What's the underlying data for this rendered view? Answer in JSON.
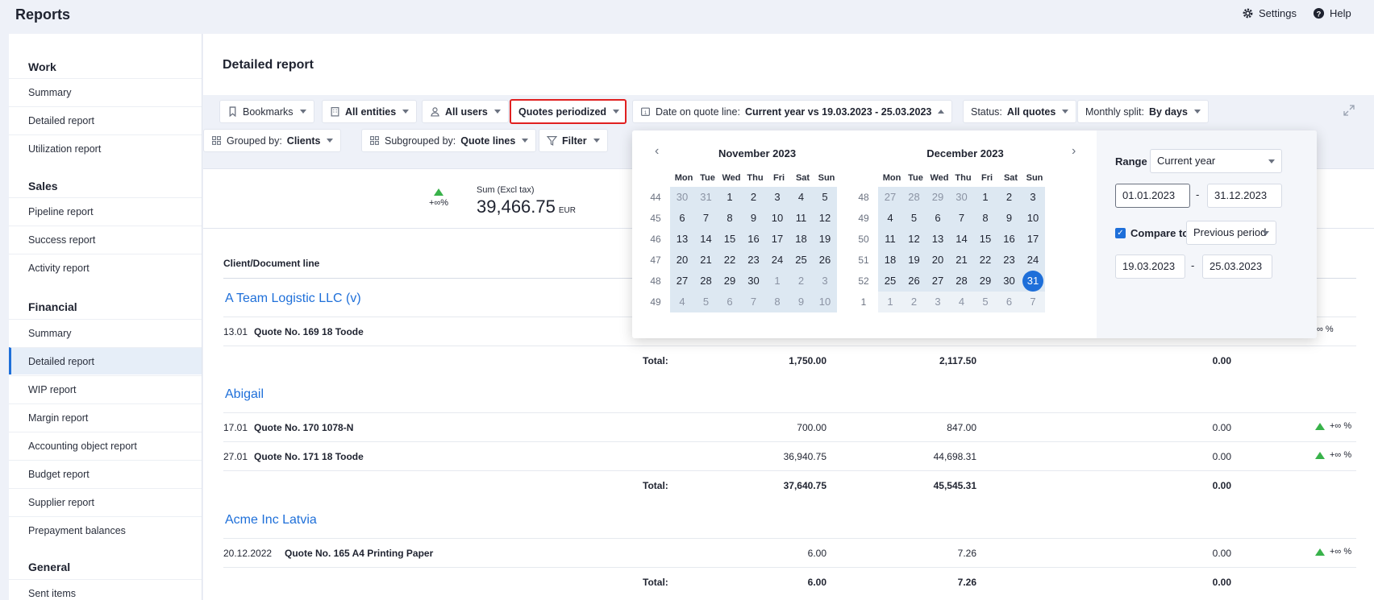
{
  "app": {
    "title": "Reports",
    "settings_label": "Settings",
    "help_label": "Help"
  },
  "sidebar": {
    "sections": [
      {
        "title": "Work",
        "items": [
          "Summary",
          "Detailed report",
          "Utilization report"
        ]
      },
      {
        "title": "Sales",
        "items": [
          "Pipeline report",
          "Success report",
          "Activity report"
        ]
      },
      {
        "title": "Financial",
        "items": [
          "Summary",
          "Detailed report",
          "WIP report",
          "Margin report",
          "Accounting object report",
          "Budget report",
          "Supplier report",
          "Prepayment balances"
        ]
      },
      {
        "title": "General",
        "items": [
          "Sent items"
        ]
      }
    ],
    "active_item": "Detailed report"
  },
  "page": {
    "title": "Detailed report"
  },
  "filters": {
    "bookmarks": "Bookmarks",
    "entities": "All entities",
    "users": "All users",
    "quotes_mode": "Quotes periodized",
    "date_prefix": "Date on quote line:",
    "date_value": "Current year vs 19.03.2023 - 25.03.2023",
    "status_prefix": "Status:",
    "status_value": "All quotes",
    "split_prefix": "Monthly split:",
    "split_value": "By days",
    "grouped_prefix": "Grouped by:",
    "grouped_value": "Clients",
    "subgrouped_prefix": "Subgrouped by:",
    "subgrouped_value": "Quote lines",
    "filter_label": "Filter"
  },
  "summary": {
    "trend_text": "+∞%",
    "label": "Sum (Excl tax)",
    "value": "39,466.75",
    "currency": "EUR"
  },
  "table": {
    "column_header": "Client/Document line",
    "total_label": "Total:",
    "trend_text": "+∞ %",
    "groups": [
      {
        "client": "A Team Logistic LLC (v)",
        "rows": [
          {
            "date": "13.01",
            "desc": "Quote No. 169  18 Toode"
          }
        ],
        "total": {
          "v1": "1,750.00",
          "v2": "2,117.50",
          "v3": "0.00"
        }
      },
      {
        "client": "Abigail",
        "rows": [
          {
            "date": "17.01",
            "desc": "Quote No. 170  1078-N",
            "v1": "700.00",
            "v2": "847.00",
            "v3": "0.00"
          },
          {
            "date": "27.01",
            "desc": "Quote No. 171  18 Toode",
            "v1": "36,940.75",
            "v2": "44,698.31",
            "v3": "0.00"
          }
        ],
        "total": {
          "v1": "37,640.75",
          "v2": "45,545.31",
          "v3": "0.00"
        }
      },
      {
        "client": "Acme Inc Latvia",
        "rows": [
          {
            "date": "20.12.2022",
            "desc": "Quote No. 165  A4 Printing Paper",
            "v1": "6.00",
            "v2": "7.26",
            "v3": "0.00"
          }
        ],
        "total": {
          "v1": "6.00",
          "v2": "7.26",
          "v3": "0.00"
        }
      }
    ],
    "row0_trend": "∞ %"
  },
  "datepicker": {
    "weekdays": [
      "Mon",
      "Tue",
      "Wed",
      "Thu",
      "Fri",
      "Sat",
      "Sun"
    ],
    "months": [
      {
        "title": "November 2023",
        "weeks": [
          {
            "wk": "44",
            "days": [
              [
                "30",
                1
              ],
              [
                "31",
                1
              ],
              [
                "1",
                0
              ],
              [
                "2",
                0
              ],
              [
                "3",
                0
              ],
              [
                "4",
                0
              ],
              [
                "5",
                0
              ]
            ]
          },
          {
            "wk": "45",
            "days": [
              [
                "6",
                0
              ],
              [
                "7",
                0
              ],
              [
                "8",
                0
              ],
              [
                "9",
                0
              ],
              [
                "10",
                0
              ],
              [
                "11",
                0
              ],
              [
                "12",
                0
              ]
            ]
          },
          {
            "wk": "46",
            "days": [
              [
                "13",
                0
              ],
              [
                "14",
                0
              ],
              [
                "15",
                0
              ],
              [
                "16",
                0
              ],
              [
                "17",
                0
              ],
              [
                "18",
                0
              ],
              [
                "19",
                0
              ]
            ]
          },
          {
            "wk": "47",
            "days": [
              [
                "20",
                0
              ],
              [
                "21",
                0
              ],
              [
                "22",
                0
              ],
              [
                "23",
                0
              ],
              [
                "24",
                0
              ],
              [
                "25",
                0
              ],
              [
                "26",
                0
              ]
            ]
          },
          {
            "wk": "48",
            "days": [
              [
                "27",
                0
              ],
              [
                "28",
                0
              ],
              [
                "29",
                0
              ],
              [
                "30",
                0
              ],
              [
                "1",
                1
              ],
              [
                "2",
                1
              ],
              [
                "3",
                1
              ]
            ]
          },
          {
            "wk": "49",
            "days": [
              [
                "4",
                1
              ],
              [
                "5",
                1
              ],
              [
                "6",
                1
              ],
              [
                "7",
                1
              ],
              [
                "8",
                1
              ],
              [
                "9",
                1
              ],
              [
                "10",
                1
              ]
            ]
          }
        ]
      },
      {
        "title": "December 2023",
        "weeks": [
          {
            "wk": "48",
            "days": [
              [
                "27",
                1
              ],
              [
                "28",
                1
              ],
              [
                "29",
                1
              ],
              [
                "30",
                1
              ],
              [
                "1",
                0
              ],
              [
                "2",
                0
              ],
              [
                "3",
                0
              ]
            ]
          },
          {
            "wk": "49",
            "days": [
              [
                "4",
                0
              ],
              [
                "5",
                0
              ],
              [
                "6",
                0
              ],
              [
                "7",
                0
              ],
              [
                "8",
                0
              ],
              [
                "9",
                0
              ],
              [
                "10",
                0
              ]
            ]
          },
          {
            "wk": "50",
            "days": [
              [
                "11",
                0
              ],
              [
                "12",
                0
              ],
              [
                "13",
                0
              ],
              [
                "14",
                0
              ],
              [
                "15",
                0
              ],
              [
                "16",
                0
              ],
              [
                "17",
                0
              ]
            ]
          },
          {
            "wk": "51",
            "days": [
              [
                "18",
                0
              ],
              [
                "19",
                0
              ],
              [
                "20",
                0
              ],
              [
                "21",
                0
              ],
              [
                "22",
                0
              ],
              [
                "23",
                0
              ],
              [
                "24",
                0
              ]
            ]
          },
          {
            "wk": "52",
            "days": [
              [
                "25",
                0
              ],
              [
                "26",
                0
              ],
              [
                "27",
                0
              ],
              [
                "28",
                0
              ],
              [
                "29",
                0
              ],
              [
                "30",
                0
              ],
              [
                "31",
                2
              ]
            ]
          },
          {
            "wk": "1",
            "days": [
              [
                "1",
                3
              ],
              [
                "2",
                3
              ],
              [
                "3",
                3
              ],
              [
                "4",
                3
              ],
              [
                "5",
                3
              ],
              [
                "6",
                3
              ],
              [
                "7",
                3
              ]
            ]
          }
        ]
      }
    ],
    "range_label": "Range",
    "range_value": "Current year",
    "start_date": "01.01.2023",
    "end_date": "31.12.2023",
    "compare_label": "Compare to",
    "compare_checked": true,
    "compare_value": "Previous period",
    "compare_start": "19.03.2023",
    "compare_end": "25.03.2023",
    "separator": "-"
  },
  "colors": {
    "accent": "#1e6fd9",
    "trend_up": "#38b24a",
    "highlight_border": "#e02020"
  }
}
